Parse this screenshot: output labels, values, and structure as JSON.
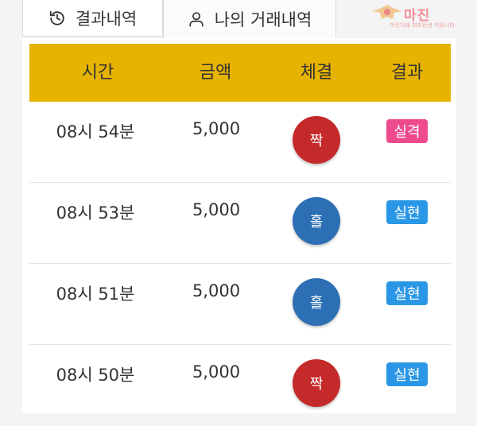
{
  "tabs": [
    {
      "label": "결과내역",
      "icon": "history-icon"
    },
    {
      "label": "나의 거래내역",
      "icon": "user-icon"
    }
  ],
  "logo": {
    "text": "마진",
    "sub": "마진거래 최초탄생 커뮤니티"
  },
  "table": {
    "headers": [
      "시간",
      "금액",
      "체결",
      "결과"
    ],
    "rows": [
      {
        "time": "08시 54분",
        "amount": "5,000",
        "fill": "짝",
        "fill_color": "#c42a2a",
        "result": "실격",
        "result_color": "#ee4a8e"
      },
      {
        "time": "08시 53분",
        "amount": "5,000",
        "fill": "홀",
        "fill_color": "#2c6fb5",
        "result": "실현",
        "result_color": "#2a97e6"
      },
      {
        "time": "08시 51분",
        "amount": "5,000",
        "fill": "홀",
        "fill_color": "#2c6fb5",
        "result": "실현",
        "result_color": "#2a97e6"
      },
      {
        "time": "08시 50분",
        "amount": "5,000",
        "fill": "짝",
        "fill_color": "#c42a2a",
        "result": "실현",
        "result_color": "#2a97e6"
      }
    ]
  },
  "colors": {
    "header_bg": "#e6b300"
  }
}
